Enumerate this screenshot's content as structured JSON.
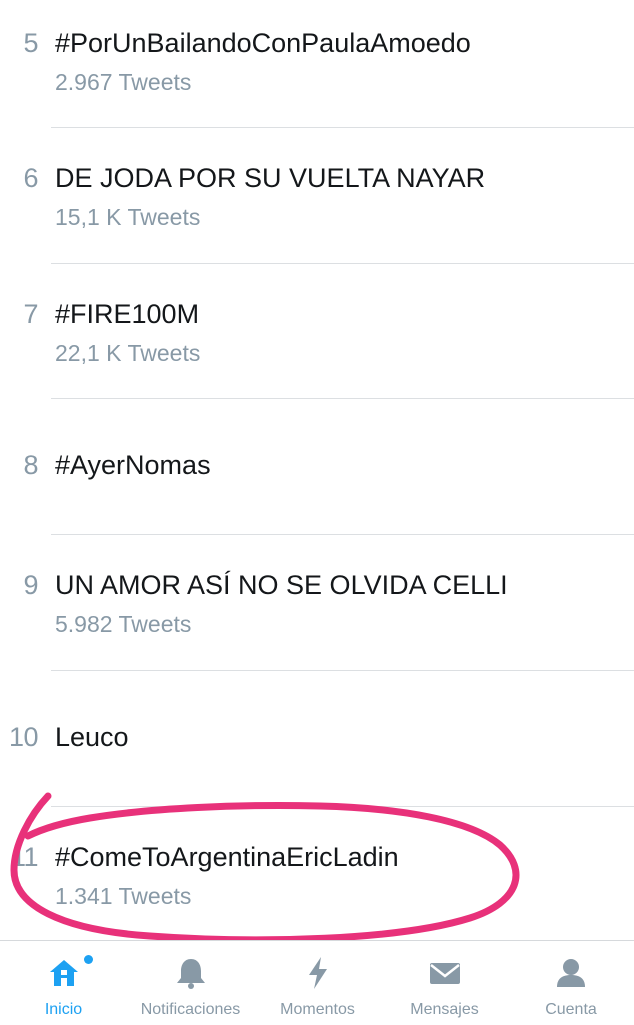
{
  "trends": [
    {
      "rank": "5",
      "name": "#PorUnBailandoConPaulaAmoedo",
      "count": "2.967 Tweets"
    },
    {
      "rank": "6",
      "name": "DE JODA POR SU VUELTA NAYAR",
      "count": "15,1 K Tweets"
    },
    {
      "rank": "7",
      "name": "#FIRE100M",
      "count": "22,1 K Tweets"
    },
    {
      "rank": "8",
      "name": "#AyerNomas",
      "count": ""
    },
    {
      "rank": "9",
      "name": "UN AMOR ASÍ NO SE OLVIDA CELLI",
      "count": "5.982 Tweets"
    },
    {
      "rank": "10",
      "name": "Leuco",
      "count": ""
    },
    {
      "rank": "11",
      "name": "#ComeToArgentinaEricLadin",
      "count": "1.341 Tweets"
    }
  ],
  "tabbar": {
    "items": [
      {
        "label": "Inicio",
        "icon": "home-icon",
        "active": true
      },
      {
        "label": "Notificaciones",
        "icon": "bell-icon",
        "active": false
      },
      {
        "label": "Momentos",
        "icon": "lightning-icon",
        "active": false
      },
      {
        "label": "Mensajes",
        "icon": "envelope-icon",
        "active": false
      },
      {
        "label": "Cuenta",
        "icon": "person-icon",
        "active": false
      }
    ]
  },
  "colors": {
    "accent": "#1da1f2",
    "muted": "#8899a6",
    "text": "#14171a",
    "annotation": "#e8317a"
  }
}
